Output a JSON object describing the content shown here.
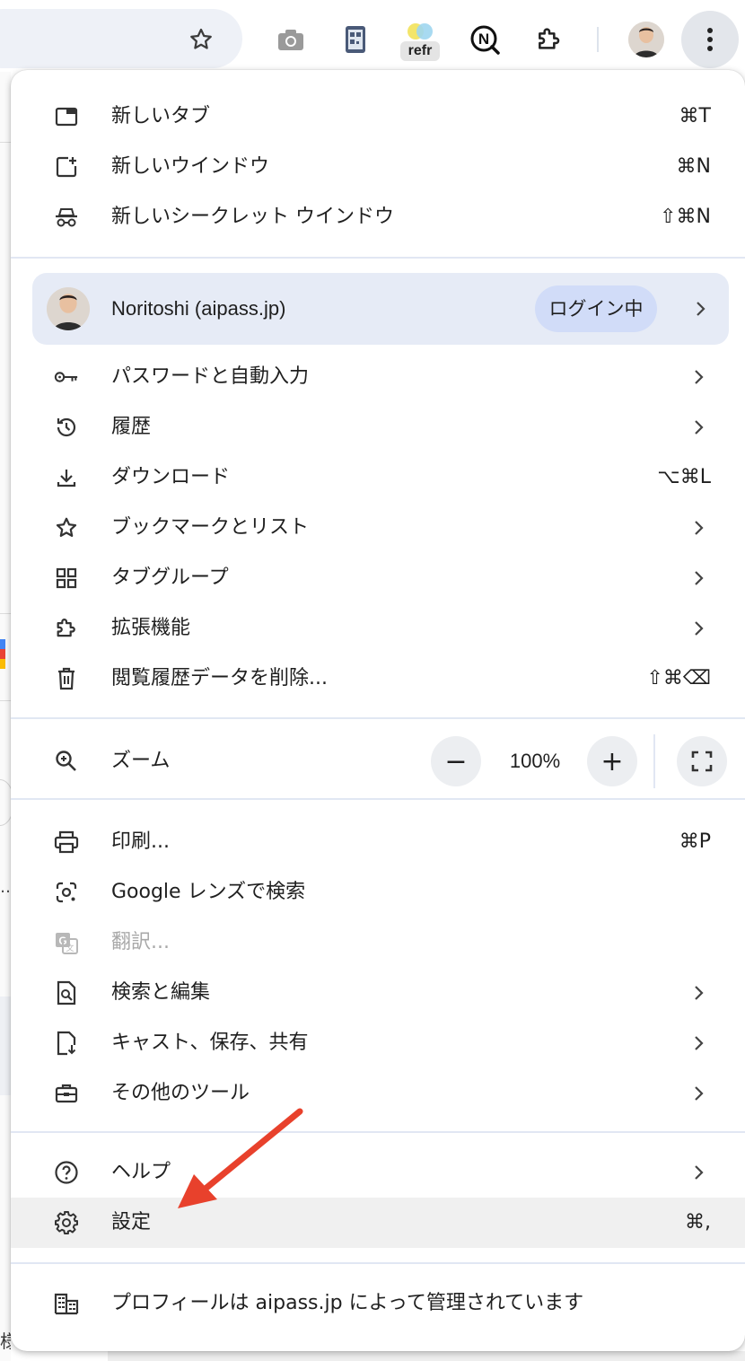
{
  "toolbar": {
    "extension_label": "refr",
    "icons": [
      "star-icon",
      "camera-icon",
      "qr-extension-icon",
      "refr-extension-icon",
      "notion-extension-icon",
      "puzzle-icon",
      "avatar",
      "kebab-menu-icon"
    ]
  },
  "menu": {
    "group1": [
      {
        "label": "新しいタブ",
        "shortcut": "⌘T",
        "icon": "new-tab-icon"
      },
      {
        "label": "新しいウインドウ",
        "shortcut": "⌘N",
        "icon": "new-window-icon"
      },
      {
        "label": "新しいシークレット ウインドウ",
        "shortcut": "⇧⌘N",
        "icon": "incognito-icon"
      }
    ],
    "profile": {
      "name": "Noritoshi (aipass.jp)",
      "status": "ログイン中"
    },
    "group2": [
      {
        "label": "パスワードと自動入力",
        "icon": "key-icon",
        "chevron": true
      },
      {
        "label": "履歴",
        "icon": "history-icon",
        "chevron": true
      },
      {
        "label": "ダウンロード",
        "shortcut": "⌥⌘L",
        "icon": "download-icon"
      },
      {
        "label": "ブックマークとリスト",
        "icon": "star-icon",
        "chevron": true
      },
      {
        "label": "タブグループ",
        "icon": "grid-icon",
        "chevron": true
      },
      {
        "label": "拡張機能",
        "icon": "puzzle-icon",
        "chevron": true
      },
      {
        "label": "閲覧履歴データを削除...",
        "shortcut": "⇧⌘⌫",
        "icon": "trash-icon"
      }
    ],
    "zoom": {
      "label": "ズーム",
      "minus": "−",
      "value": "100%",
      "plus": "+"
    },
    "group3": [
      {
        "label": "印刷...",
        "shortcut": "⌘P",
        "icon": "print-icon"
      },
      {
        "label": "Google レンズで検索",
        "icon": "lens-icon"
      },
      {
        "label": "翻訳...",
        "icon": "translate-icon",
        "disabled": true
      },
      {
        "label": "検索と編集",
        "icon": "find-icon",
        "chevron": true
      },
      {
        "label": "キャスト、保存、共有",
        "icon": "save-icon",
        "chevron": true
      },
      {
        "label": "その他のツール",
        "icon": "toolbox-icon",
        "chevron": true
      }
    ],
    "group4": [
      {
        "label": "ヘルプ",
        "icon": "help-icon",
        "chevron": true
      },
      {
        "label": "設定",
        "shortcut": "⌘,",
        "icon": "gear-icon"
      }
    ],
    "managed": {
      "label": "プロフィールは aipass.jp によって管理されています",
      "icon": "building-icon"
    }
  },
  "colors": {
    "accent_arrow": "#e8412c",
    "profile_bg": "#e6ebf6",
    "badge_bg": "#d1dcf8"
  }
}
